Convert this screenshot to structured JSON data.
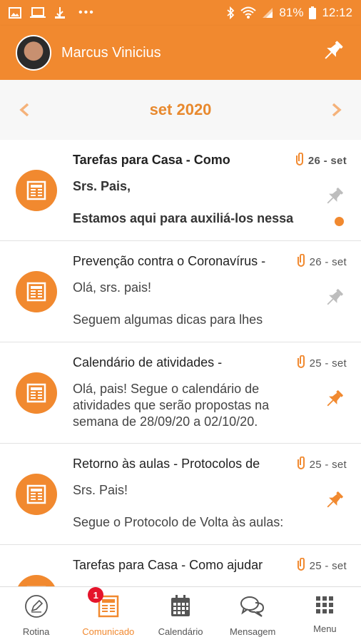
{
  "status_bar": {
    "battery": "81%",
    "time": "12:12",
    "dots": "•••",
    "icons": [
      "image-icon",
      "laptop-icon",
      "usb-icon",
      "bluetooth-icon",
      "wifi-icon",
      "signal-icon",
      "battery-icon"
    ]
  },
  "header": {
    "user_name": "Marcus Vinicius",
    "pin_icon": "pin-icon"
  },
  "month_nav": {
    "label": "set 2020",
    "prev_icon": "chevron-left-icon",
    "next_icon": "chevron-right-icon"
  },
  "colors": {
    "accent": "#f1892f",
    "pinned": "#f1892f",
    "unpinned": "#bdbdbd",
    "badge": "#e5142b"
  },
  "messages": [
    {
      "title": "Tarefas para Casa - Como",
      "date": "26 - set",
      "body": [
        "Srs. Pais,",
        "Estamos aqui para auxiliá-los nessa"
      ],
      "unread": true,
      "pinned": false,
      "attachment": true
    },
    {
      "title": "Prevenção contra o Coronavírus -",
      "date": "26 - set",
      "body": [
        "Olá, srs. pais!",
        "Seguem algumas dicas para lhes"
      ],
      "unread": false,
      "pinned": false,
      "attachment": true
    },
    {
      "title": "Calendário de atividades -",
      "date": "25 - set",
      "body": [
        "Olá, pais!  Segue o calendário de atividades que serão propostas na semana de 28/09/20 a 02/10/20."
      ],
      "unread": false,
      "pinned": true,
      "attachment": true
    },
    {
      "title": "Retorno às aulas - Protocolos de",
      "date": "25 - set",
      "body": [
        "Srs. Pais!",
        "Segue o Protocolo de Volta às aulas:"
      ],
      "unread": false,
      "pinned": true,
      "attachment": true
    },
    {
      "title": "Tarefas para Casa - Como ajudar",
      "date": "25 - set",
      "body": [],
      "unread": false,
      "pinned": false,
      "attachment": true
    }
  ],
  "bottom_nav": {
    "items": [
      {
        "label": "Rotina",
        "icon": "pencil-circle-icon"
      },
      {
        "label": "Comunicado",
        "icon": "newspaper-icon",
        "badge": "1"
      },
      {
        "label": "Calendário",
        "icon": "calendar-icon"
      },
      {
        "label": "Mensagem",
        "icon": "chat-bubbles-icon"
      },
      {
        "label": "Menu",
        "icon": "grid-icon"
      }
    ]
  }
}
